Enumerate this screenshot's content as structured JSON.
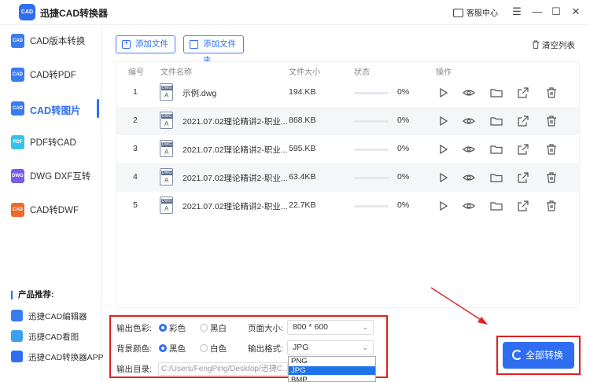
{
  "app": {
    "logo_text": "CAD",
    "title": "迅捷CAD转换器",
    "service_label": "客服中心"
  },
  "window": {
    "minimize": "—",
    "restore": "☐",
    "close": "✕",
    "menu": "☰"
  },
  "sidebar": {
    "items": [
      {
        "label": "CAD版本转换",
        "icon_text": "CAD",
        "color": "#3a7bf0",
        "active": false
      },
      {
        "label": "CAD转PDF",
        "icon_text": "CAD",
        "color": "#3a7bf0",
        "active": false
      },
      {
        "label": "CAD转图片",
        "icon_text": "CAD",
        "color": "#3a7bf0",
        "active": true
      },
      {
        "label": "PDF转CAD",
        "icon_text": "PDF",
        "color": "#3ac0e8",
        "active": false
      },
      {
        "label": "DWG DXF互转",
        "icon_text": "DWG",
        "color": "#7a5af0",
        "active": false
      },
      {
        "label": "CAD转DWF",
        "icon_text": "CAD",
        "color": "#f06a2a",
        "active": false
      }
    ],
    "recommend_title": "产品推荐:",
    "recommend": [
      {
        "label": "迅捷CAD编辑器",
        "color": "#3a7bf0"
      },
      {
        "label": "迅捷CAD看图",
        "color": "#3aa0f0"
      },
      {
        "label": "迅捷CAD转换器APP",
        "color": "#2f6ef0"
      }
    ]
  },
  "toolbar": {
    "add_file": "添加文件",
    "add_folder": "添加文件夹",
    "clear_list": "清空列表"
  },
  "table": {
    "headers": [
      "编号",
      "文件名称",
      "文件大小",
      "状态",
      "操作"
    ],
    "file_icon_text": "DWG",
    "rows": [
      {
        "num": "1",
        "name": "示例.dwg",
        "size": "194.KB",
        "percent": "0%",
        "progress": 0
      },
      {
        "num": "2",
        "name": "2021.07.02理论精讲2-职业...",
        "size": "868.KB",
        "percent": "0%",
        "progress": 0
      },
      {
        "num": "3",
        "name": "2021.07.02理论精讲2-职业...",
        "size": "595.KB",
        "percent": "0%",
        "progress": 0
      },
      {
        "num": "4",
        "name": "2021.07.02理论精讲2-职业...",
        "size": "63.4KB",
        "percent": "0%",
        "progress": 0
      },
      {
        "num": "5",
        "name": "2021.07.02理论精讲2-职业...",
        "size": "22.7KB",
        "percent": "0%",
        "progress": 0
      }
    ]
  },
  "settings": {
    "color_label": "输出色彩:",
    "color_options": [
      "彩色",
      "黑白"
    ],
    "color_selected": 0,
    "bg_label": "背景颜色:",
    "bg_options": [
      "黑色",
      "白色"
    ],
    "bg_selected": 0,
    "page_size_label": "页面大小:",
    "page_size_value": "800 * 600",
    "format_label": "输出格式:",
    "format_value": "JPG",
    "format_options": [
      "PNG",
      "JPG",
      "BMP"
    ],
    "format_selected": 1,
    "dir_label": "输出目录:",
    "dir_value": "C:/Users/FengPing/Desktop/迅捷C..."
  },
  "convert_label": "全部转换",
  "colors": {
    "accent": "#2f6ef0",
    "annotation_red": "#e11f1f"
  }
}
